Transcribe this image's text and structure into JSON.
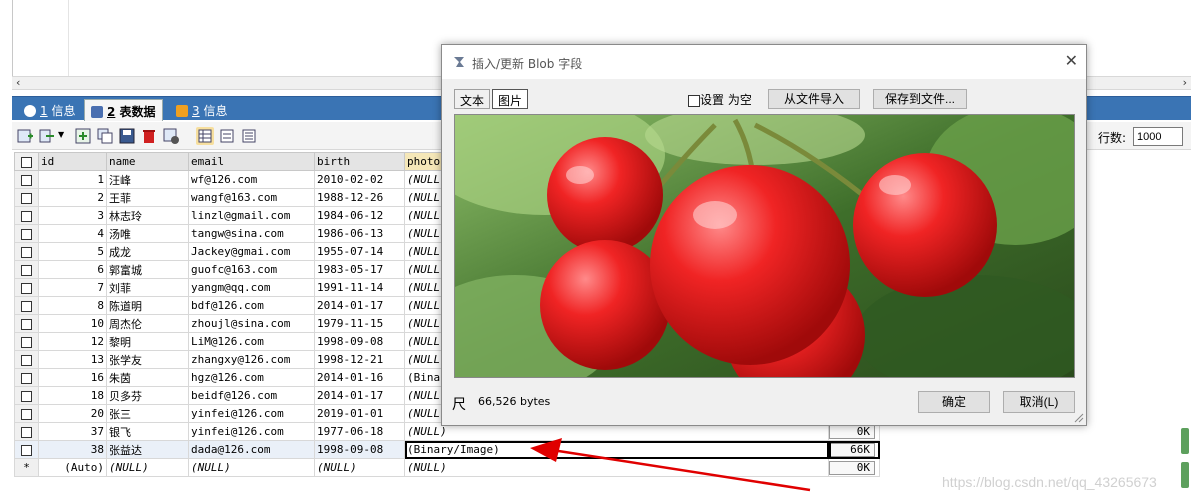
{
  "tabs": [
    {
      "num": "1",
      "label": "信息"
    },
    {
      "num": "2",
      "label": "表数据"
    },
    {
      "num": "3",
      "label": "信息"
    }
  ],
  "toolbar": {
    "rows_label": "行数:",
    "rows_value": "1000"
  },
  "grid": {
    "columns": [
      "id",
      "name",
      "email",
      "birth",
      "photo"
    ],
    "rows": [
      {
        "id": "1",
        "name": "汪峰",
        "email": "wf@126.com",
        "birth": "2010-02-02",
        "photo": "(NULL)"
      },
      {
        "id": "2",
        "name": "王菲",
        "email": "wangf@163.com",
        "birth": "1988-12-26",
        "photo": "(NULL)"
      },
      {
        "id": "3",
        "name": "林志玲",
        "email": "linzl@gmail.com",
        "birth": "1984-06-12",
        "photo": "(NULL)"
      },
      {
        "id": "4",
        "name": "汤唯",
        "email": "tangw@sina.com",
        "birth": "1986-06-13",
        "photo": "(NULL)"
      },
      {
        "id": "5",
        "name": "成龙",
        "email": "Jackey@gmai.com",
        "birth": "1955-07-14",
        "photo": "(NULL)"
      },
      {
        "id": "6",
        "name": "郭富城",
        "email": "guofc@163.com",
        "birth": "1983-05-17",
        "photo": "(NULL)"
      },
      {
        "id": "7",
        "name": "刘菲",
        "email": "yangm@qq.com",
        "birth": "1991-11-14",
        "photo": "(NULL)"
      },
      {
        "id": "8",
        "name": "陈道明",
        "email": "bdf@126.com",
        "birth": "2014-01-17",
        "photo": "(NULL)"
      },
      {
        "id": "10",
        "name": "周杰伦",
        "email": "zhoujl@sina.com",
        "birth": "1979-11-15",
        "photo": "(NULL)"
      },
      {
        "id": "12",
        "name": "黎明",
        "email": "LiM@126.com",
        "birth": "1998-09-08",
        "photo": "(NULL)"
      },
      {
        "id": "13",
        "name": "张学友",
        "email": "zhangxy@126.com",
        "birth": "1998-12-21",
        "photo": "(NULL)"
      },
      {
        "id": "16",
        "name": "朱茵",
        "email": "hgz@126.com",
        "birth": "2014-01-16",
        "photo": "(Bina"
      },
      {
        "id": "18",
        "name": "贝多芬",
        "email": "beidf@126.com",
        "birth": "2014-01-17",
        "photo": "(NULL)"
      },
      {
        "id": "20",
        "name": "张三",
        "email": "yinfei@126.com",
        "birth": "2019-01-01",
        "photo": "(NULL)"
      },
      {
        "id": "37",
        "name": "银飞",
        "email": "yinfei@126.com",
        "birth": "1977-06-18",
        "photo": "(NULL)",
        "size": "0K"
      },
      {
        "id": "38",
        "name": "张益达",
        "email": "dada@126.com",
        "birth": "1998-09-08",
        "photo": "(Binary/Image)",
        "size": "66K"
      },
      {
        "id": "(Auto)",
        "name": "(NULL)",
        "email": "(NULL)",
        "birth": "(NULL)",
        "photo": "(NULL)",
        "size": "0K",
        "marker": "*"
      }
    ]
  },
  "dialog": {
    "title": "插入/更新 Blob 字段",
    "tab_text": "文本",
    "tab_image": "图片",
    "set_null": "设置 为空",
    "import_btn": "从文件导入",
    "save_btn": "保存到文件...",
    "resize_icon": "尺",
    "bytes": "66,526 bytes",
    "ok": "确定",
    "cancel": "取消(L)"
  },
  "watermark": "https://blog.csdn.net/qq_43265673",
  "colors": {
    "tabbar": "#3a74b4",
    "arrow": "#e00000",
    "header_sel": "#f5e7b8"
  }
}
